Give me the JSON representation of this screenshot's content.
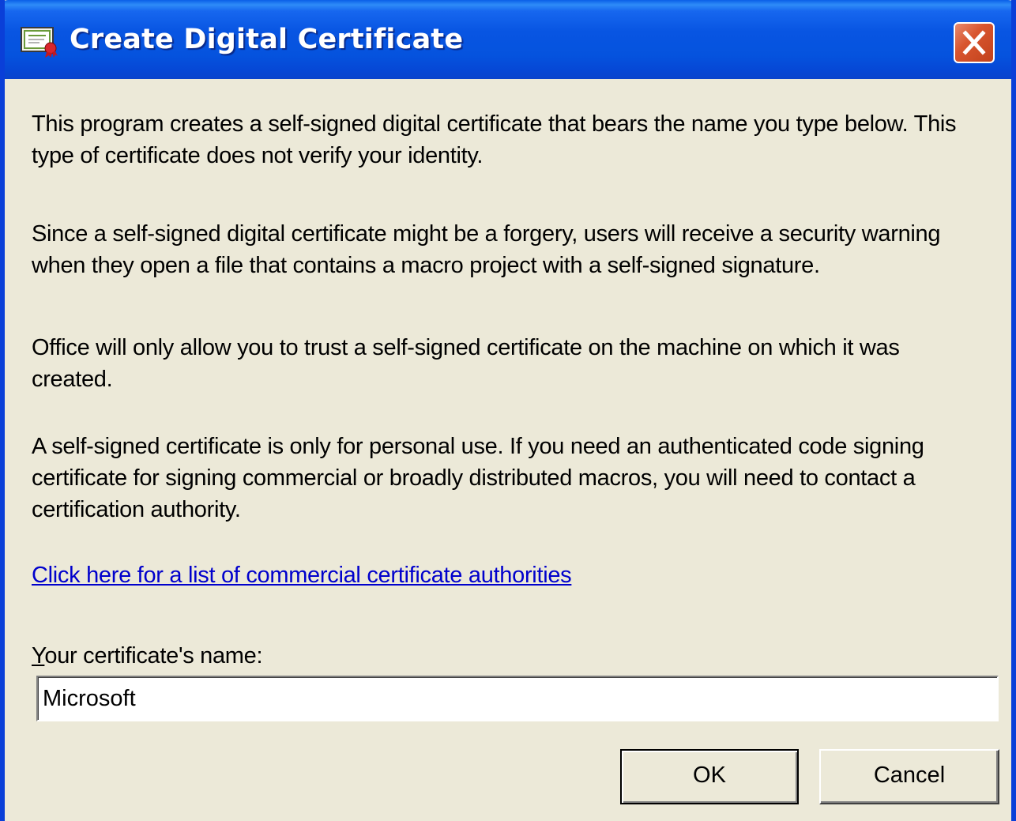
{
  "window": {
    "title": "Create Digital Certificate",
    "icon": "certificate-icon",
    "close_icon": "close-icon"
  },
  "body": {
    "paragraph_1": "This program creates a self-signed digital certificate that bears the name you type below. This type of certificate does not verify your identity.",
    "paragraph_2": "Since a self-signed digital certificate might be a forgery, users will receive a security warning when they open a file that contains a macro project with a self-signed signature.",
    "paragraph_3": "Office will only allow you to trust a self-signed certificate on the machine on which it was created.",
    "paragraph_4": "A self-signed certificate is only for personal use. If you need an authenticated code signing certificate for signing commercial or broadly distributed macros, you will need to contact a certification authority.",
    "link_text": "Click here for a list of commercial certificate authorities"
  },
  "form": {
    "name_label_mnemonic": "Y",
    "name_label_rest": "our certificate's name:",
    "name_value": "Microsoft"
  },
  "buttons": {
    "ok_label": "OK",
    "cancel_label": "Cancel"
  },
  "colors": {
    "titlebar": "#0855e2",
    "dialog_background": "#ece9d8",
    "link": "#0000cc",
    "close_button": "#d8552e"
  }
}
